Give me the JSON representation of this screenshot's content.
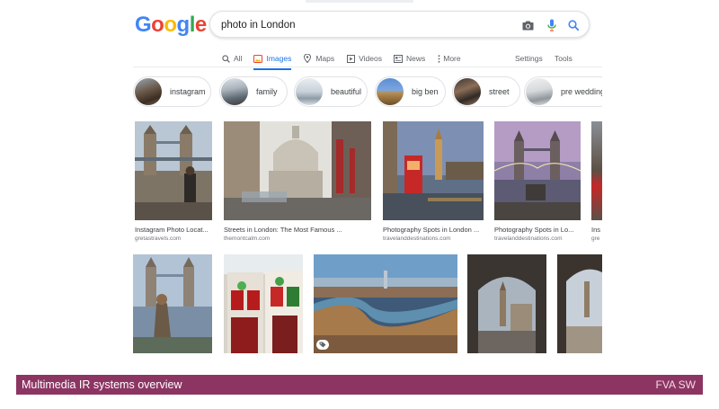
{
  "search": {
    "query": "photo in London"
  },
  "logo": {
    "letters": [
      "G",
      "o",
      "o",
      "g",
      "l",
      "e"
    ],
    "colors": [
      "#4285f4",
      "#ea4335",
      "#fbbc05",
      "#4285f4",
      "#34a853",
      "#ea4335"
    ]
  },
  "tabs": [
    {
      "label": "All",
      "icon": "search-icon"
    },
    {
      "label": "Images",
      "icon": "image-icon",
      "active": true
    },
    {
      "label": "Maps",
      "icon": "map-pin-icon"
    },
    {
      "label": "Videos",
      "icon": "video-icon"
    },
    {
      "label": "News",
      "icon": "newspaper-icon"
    },
    {
      "label": "More",
      "icon": "more-vert-icon"
    }
  ],
  "settings_label": "Settings",
  "tools_label": "Tools",
  "chips": [
    {
      "label": "instagram"
    },
    {
      "label": "family"
    },
    {
      "label": "beautiful"
    },
    {
      "label": "big ben"
    },
    {
      "label": "street"
    },
    {
      "label": "pre wedding"
    }
  ],
  "results_row1": [
    {
      "title": "Instagram Photo Locat...",
      "source": "gretastravels.com"
    },
    {
      "title": "Streets in London: The Most Famous ...",
      "source": "themontcalm.com"
    },
    {
      "title": "Photography Spots in London ...",
      "source": "travelanddestinations.com"
    },
    {
      "title": "Photography Spots in Lo...",
      "source": "travelanddestinations.com"
    },
    {
      "title": "Ins",
      "source": "gre"
    }
  ],
  "footer": {
    "left": "Multimedia IR systems overview",
    "right": "FVA SW"
  },
  "colors": {
    "accent": "#1a73e8",
    "footer_bar": "#8c3562"
  }
}
